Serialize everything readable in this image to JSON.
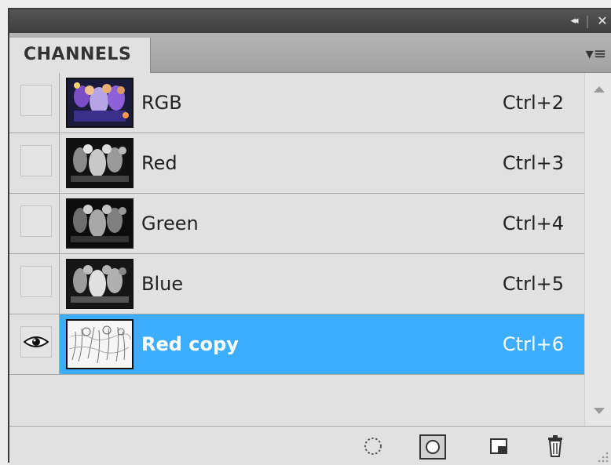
{
  "panel": {
    "tab_label": "CHANNELS",
    "collapse_glyph": "◂◂",
    "separator_glyph": "|",
    "close_glyph": "✕",
    "menu_glyph": "▾≡"
  },
  "channels": [
    {
      "name": "RGB",
      "shortcut": "Ctrl+2",
      "visible": false,
      "selected": false,
      "thumbnail": "color-photo"
    },
    {
      "name": "Red",
      "shortcut": "Ctrl+3",
      "visible": false,
      "selected": false,
      "thumbnail": "grayscale-photo"
    },
    {
      "name": "Green",
      "shortcut": "Ctrl+4",
      "visible": false,
      "selected": false,
      "thumbnail": "grayscale-photo"
    },
    {
      "name": "Blue",
      "shortcut": "Ctrl+5",
      "visible": false,
      "selected": false,
      "thumbnail": "grayscale-photo"
    },
    {
      "name": "Red copy",
      "shortcut": "Ctrl+6",
      "visible": true,
      "selected": true,
      "thumbnail": "sketch-photo"
    }
  ],
  "bottom_buttons": [
    {
      "icon": "load-selection-icon"
    },
    {
      "icon": "save-selection-icon"
    },
    {
      "icon": "new-channel-icon"
    },
    {
      "icon": "delete-channel-icon"
    }
  ],
  "colors": {
    "selection": "#3daeff",
    "panel_bg": "#e1e1e1",
    "titlebar": "#444444"
  }
}
